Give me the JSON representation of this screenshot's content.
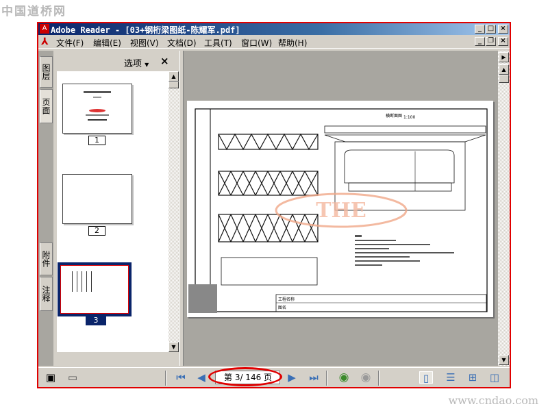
{
  "watermark_top": "中国道桥网",
  "watermark_bottom": "www.cndao.com",
  "window": {
    "title": "Adobe Reader - [03+钢桁梁图纸-陈耀军.pdf]"
  },
  "menu": [
    "文件(F)",
    "编辑(E)",
    "视图(V)",
    "文档(D)",
    "工具(T)",
    "窗口(W)",
    "帮助(H)"
  ],
  "side_tabs": [
    "图层",
    "页面",
    "附件",
    "注释"
  ],
  "panel": {
    "options_label": "选项",
    "close": "×",
    "thumbnails": [
      "1",
      "2",
      "3"
    ],
    "selected": "3"
  },
  "drawing": {
    "section_title": "横断面图",
    "scale": "1:100",
    "project_label": "工程名称",
    "drawing_label": "图名",
    "logo": "THE"
  },
  "navigation": {
    "page_display": "第 3/ 146 页",
    "current_page": 3,
    "total_pages": 146
  },
  "colors": {
    "highlight": "#e00000",
    "selection": "#0a246a"
  }
}
